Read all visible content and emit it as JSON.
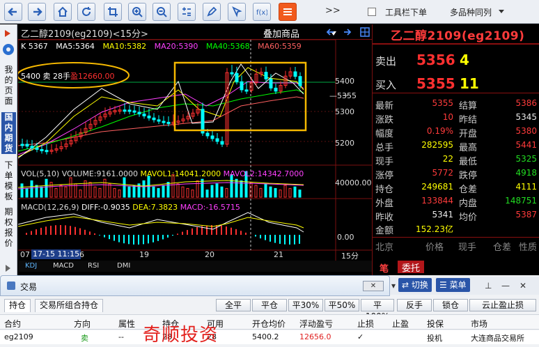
{
  "toolbar": {
    "more": ">>",
    "toolbar_menu_label": "工具栏下单",
    "multi_contract_label": "多品种同列"
  },
  "sidebar": {
    "items": [
      "我的页面",
      "国内期货",
      "下单模板",
      "期权报价"
    ]
  },
  "chart": {
    "contract_title": "乙二醇2109(eg2109)",
    "period": "<15分>",
    "overlay_label": "叠加商品",
    "k_value": "K 5367",
    "ma": [
      {
        "label": "MA5:5364",
        "color": "#ffffff"
      },
      {
        "label": "MA10:5382",
        "color": "#ffff00"
      },
      {
        "label": "MA20:5390",
        "color": "#ff40ff"
      },
      {
        "label": "MA40:5368",
        "color": "#00ff00"
      },
      {
        "label": "MA60:5359",
        "color": "#ff6060"
      }
    ],
    "position_annotation": {
      "price": "5400",
      "side": "卖",
      "lots": "28手",
      "profit_label": "盈",
      "profit": "12660.00"
    },
    "price_labels": {
      "p5400": "5400",
      "p5355": "—5355",
      "p5300": "5300",
      "p5200": "5200"
    },
    "volume": {
      "label": "VOL(5,10)",
      "volume": "VOLUME:9161.0000",
      "mavol1": "MAVOL1:14041.2000",
      "mavol2": "MAVOL2:14342.7000",
      "scale": "40000.00"
    },
    "macd": {
      "label": "MACD(12,26,9)",
      "diff": "DIFF:-0.9035",
      "dea": "DEA:7.3823",
      "macd": "MACD:-16.5715",
      "scale": "0.00"
    },
    "dates": {
      "d_start": "07",
      "cursor": "17-15 11:15",
      "d_cursor_tail": "6",
      "d19": "19",
      "d20": "20",
      "d21": "21"
    },
    "time_unit": "15分",
    "indicator_tabs": [
      "KDJ",
      "MACD",
      "RSI",
      "DMI"
    ],
    "colors": {
      "up": "#ff3030",
      "down": "#00ffff",
      "frame": "#7a1010",
      "highlight_box": "#f5b800"
    }
  },
  "quote": {
    "title": "乙二醇2109(eg2109)",
    "ask": {
      "label": "卖出",
      "price": "5356",
      "volume": "4"
    },
    "bid": {
      "label": "买入",
      "price": "5355",
      "volume": "11"
    },
    "rows": [
      {
        "l1": "最新",
        "v1": "5355",
        "c1": "red",
        "l2": "结算",
        "v2": "5386",
        "c2": "red"
      },
      {
        "l1": "涨跌",
        "v1": "10",
        "c1": "red",
        "l2": "昨结",
        "v2": "5345",
        "c2": "white"
      },
      {
        "l1": "幅度",
        "v1": "0.19%",
        "c1": "red",
        "l2": "开盘",
        "v2": "5380",
        "c2": "red"
      },
      {
        "l1": "总手",
        "v1": "282595",
        "c1": "yellow",
        "l2": "最高",
        "v2": "5441",
        "c2": "red"
      },
      {
        "l1": "现手",
        "v1": "22",
        "c1": "yellow",
        "l2": "最低",
        "v2": "5325",
        "c2": "green"
      },
      {
        "l1": "涨停",
        "v1": "5772",
        "c1": "red",
        "l2": "跌停",
        "v2": "4918",
        "c2": "green"
      },
      {
        "l1": "持仓",
        "v1": "249681",
        "c1": "yellow",
        "l2": "仓差",
        "v2": "4111",
        "c2": "yellow"
      },
      {
        "l1": "外盘",
        "v1": "133844",
        "c1": "red",
        "l2": "内盘",
        "v2": "148751",
        "c2": "green"
      },
      {
        "l1": "昨收",
        "v1": "5341",
        "c1": "white",
        "l2": "均价",
        "v2": "5387",
        "c2": "red"
      }
    ],
    "amount": {
      "label": "金额",
      "value": "152.23亿"
    },
    "columns": [
      "北京",
      "价格",
      "现手",
      "仓差",
      "性质"
    ],
    "tab_bi": "笔",
    "tab_entrust": "委托"
  },
  "trade": {
    "title": "交易",
    "close": "✕",
    "toolbar2": {
      "switch": "切换",
      "menu": "菜单"
    },
    "tabs": [
      "持仓",
      "交易所组合持仓"
    ],
    "actions": [
      "全平",
      "平仓",
      "平30%",
      "平50%",
      "平100%",
      "反手",
      "锁仓",
      "云止盈止损"
    ],
    "columns": [
      "合约",
      "方向",
      "属性",
      "持仓",
      "可用",
      "开仓均价",
      "浮动盈亏",
      "止损",
      "止盈",
      "投保",
      "市场"
    ],
    "row": {
      "contract": "eg2109",
      "direction": "卖",
      "attr": "--",
      "hold": "28",
      "avail": "28",
      "open_price": "5400.2",
      "pnl": "12656.0",
      "stop_loss": "✓",
      "take_profit": "",
      "hedge": "投机",
      "market": "大连商品交易所"
    },
    "watermark": "奇顺投资"
  }
}
